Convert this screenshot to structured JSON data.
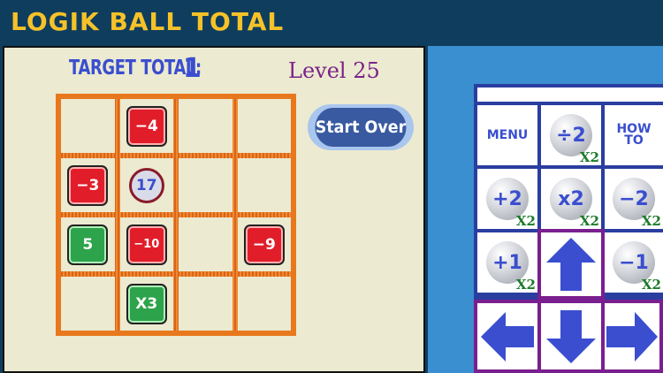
{
  "header": {
    "title": "LOGIK BALL TOTAL"
  },
  "status": {
    "target_label": "TARGET TOTAL:",
    "target_value": "1",
    "level": "Level 25"
  },
  "actions": {
    "start_over": "Start Over"
  },
  "board": {
    "rows": [
      [
        {
          "type": "empty"
        },
        {
          "type": "tile",
          "color": "red",
          "label": "−4"
        },
        {
          "type": "empty"
        },
        {
          "type": "empty"
        }
      ],
      [
        {
          "type": "tile",
          "color": "red",
          "label": "−3"
        },
        {
          "type": "ball",
          "label": "17"
        },
        {
          "type": "empty"
        },
        {
          "type": "empty"
        }
      ],
      [
        {
          "type": "tile",
          "color": "green",
          "label": "5"
        },
        {
          "type": "tile",
          "color": "red",
          "label": "−10"
        },
        {
          "type": "empty"
        },
        {
          "type": "tile",
          "color": "red",
          "label": "−9"
        }
      ],
      [
        {
          "type": "empty"
        },
        {
          "type": "tile",
          "color": "green",
          "label": "X3"
        },
        {
          "type": "empty"
        },
        {
          "type": "empty"
        }
      ]
    ]
  },
  "controls": {
    "menu": "MENU",
    "howto_line1": "HOW",
    "howto_line2": "TO",
    "divide2": {
      "label": "÷2",
      "count": "X2"
    },
    "plus2": {
      "label": "+2",
      "count": "X2"
    },
    "times2": {
      "label": "x2",
      "count": "X2"
    },
    "minus2": {
      "label": "−2",
      "count": "X2"
    },
    "plus1": {
      "label": "+1",
      "count": "X2"
    },
    "minus1": {
      "label": "−1",
      "count": "X2"
    }
  },
  "colors": {
    "title": "#f5c228",
    "header_bg": "#0f3d5e",
    "tile_red": "#e21d2a",
    "tile_green": "#2da34b",
    "arrow": "#3a4ecf",
    "arrow_frame": "#7a1f8f"
  },
  "icons": {
    "up": "arrow-up-icon",
    "down": "arrow-down-icon",
    "left": "arrow-left-icon",
    "right": "arrow-right-icon"
  }
}
